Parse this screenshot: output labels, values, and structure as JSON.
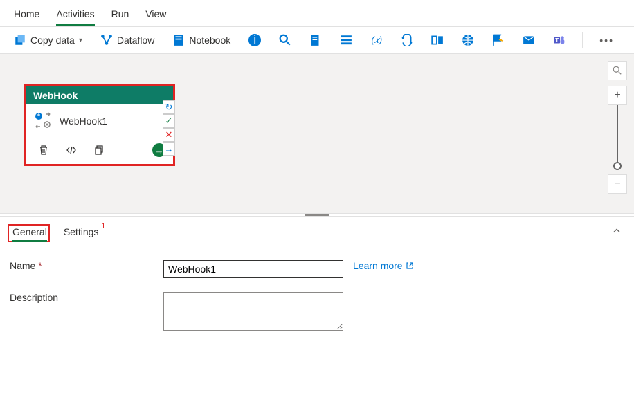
{
  "top_tabs": [
    "Home",
    "Activities",
    "Run",
    "View"
  ],
  "active_top_tab": 1,
  "toolbar": {
    "copy_data": "Copy data",
    "dataflow": "Dataflow",
    "notebook": "Notebook"
  },
  "activity": {
    "type_label": "WebHook",
    "name": "WebHook1"
  },
  "panel": {
    "tabs": [
      "General",
      "Settings"
    ],
    "active_tab": 0,
    "settings_badge": "1",
    "fields": {
      "name_label": "Name",
      "name_value": "WebHook1",
      "learn_more": "Learn more",
      "description_label": "Description",
      "description_value": ""
    }
  }
}
